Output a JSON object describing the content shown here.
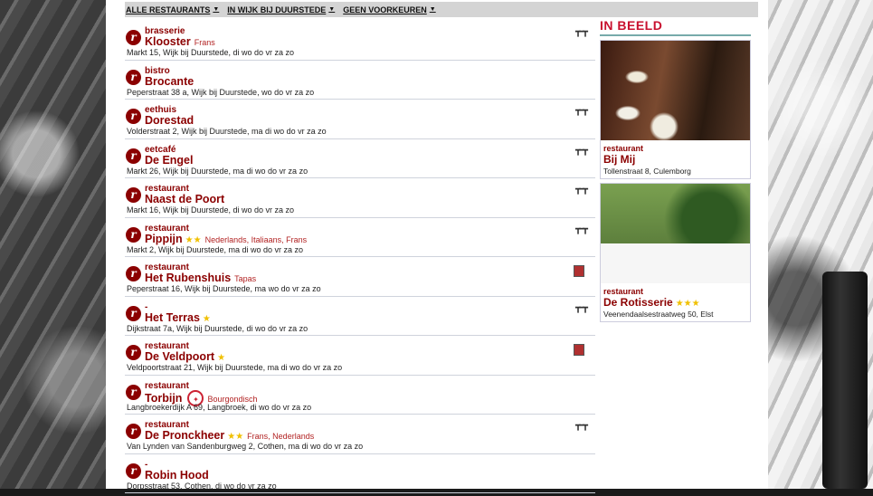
{
  "filters": [
    {
      "label": "ALLE RESTAURANTS"
    },
    {
      "label": "IN WIJK BIJ DUURSTEDE"
    },
    {
      "label": "GEEN VOORKEUREN"
    }
  ],
  "restaurants": [
    {
      "type": "brasserie",
      "name": "Klooster",
      "cuisine": "Frans",
      "stars": "",
      "address": "Markt 15, Wijk bij Duurstede, di wo do vr za zo",
      "icon": "terrace-icon"
    },
    {
      "type": "bistro",
      "name": "Brocante",
      "cuisine": "",
      "stars": "",
      "address": "Peperstraat 38 a, Wijk bij Duurstede, wo do vr za zo",
      "icon": ""
    },
    {
      "type": "eethuis",
      "name": "Dorestad",
      "cuisine": "",
      "stars": "",
      "address": "Volderstraat 2, Wijk bij Duurstede, ma di wo do vr za zo",
      "icon": "terrace-icon"
    },
    {
      "type": "eetcafé",
      "name": "De Engel",
      "cuisine": "",
      "stars": "",
      "address": "Markt 26, Wijk bij Duurstede, ma di wo do vr za zo",
      "icon": "terrace-icon"
    },
    {
      "type": "restaurant",
      "name": "Naast de Poort",
      "cuisine": "",
      "stars": "",
      "address": "Markt 16, Wijk bij Duurstede, di wo do vr za zo",
      "icon": "terrace-icon"
    },
    {
      "type": "restaurant",
      "name": "Pippijn",
      "cuisine": "Nederlands, Italiaans, Frans",
      "stars": "★★",
      "address": "Markt 2, Wijk bij Duurstede, ma di wo do vr za zo",
      "icon": "terrace-icon"
    },
    {
      "type": "restaurant",
      "name": "Het Rubenshuis",
      "cuisine": "Tapas",
      "stars": "",
      "address": "Peperstraat 16, Wijk bij Duurstede, ma wo do vr za zo",
      "icon": "book-icon"
    },
    {
      "type": "-",
      "name": "Het Terras",
      "cuisine": "",
      "stars": "★",
      "address": "Dijkstraat 7a, Wijk bij Duurstede, di wo do vr za zo",
      "icon": "terrace-icon"
    },
    {
      "type": "restaurant",
      "name": "De Veldpoort",
      "cuisine": "",
      "stars": "★",
      "address": "Veldpoortstraat 21, Wijk bij Duurstede, ma di wo do vr za zo",
      "icon": "book-icon"
    },
    {
      "type": "restaurant",
      "name": "Torbijn",
      "cuisine": "Bourgondisch",
      "stars": "",
      "address": "Langbroekerdijk A 69, Langbroek, di wo do vr za zo",
      "icon": "",
      "seal": true
    },
    {
      "type": "restaurant",
      "name": "De Pronckheer",
      "cuisine": "Frans, Nederlands",
      "stars": "★★",
      "address": "Van Lynden van Sandenburgweg 2, Cothen, ma di wo do vr za zo",
      "icon": "terrace-icon"
    },
    {
      "type": "-",
      "name": "Robin Hood",
      "cuisine": "",
      "stars": "",
      "address": "Dorpsstraat 53, Cothen, di wo do vr za zo",
      "icon": ""
    }
  ],
  "sidebar": {
    "title": "IN BEELD",
    "cards": [
      {
        "type": "restaurant",
        "name": "Bij Mij",
        "stars": "",
        "address": "Tollenstraat 8, Culemborg"
      },
      {
        "type": "restaurant",
        "name": "De Rotisserie",
        "stars": "★★★",
        "address": "Veenendaalsestraatweg 50, Elst"
      }
    ]
  },
  "colors": {
    "brand": "#8b0000",
    "accent": "#c8102e"
  }
}
